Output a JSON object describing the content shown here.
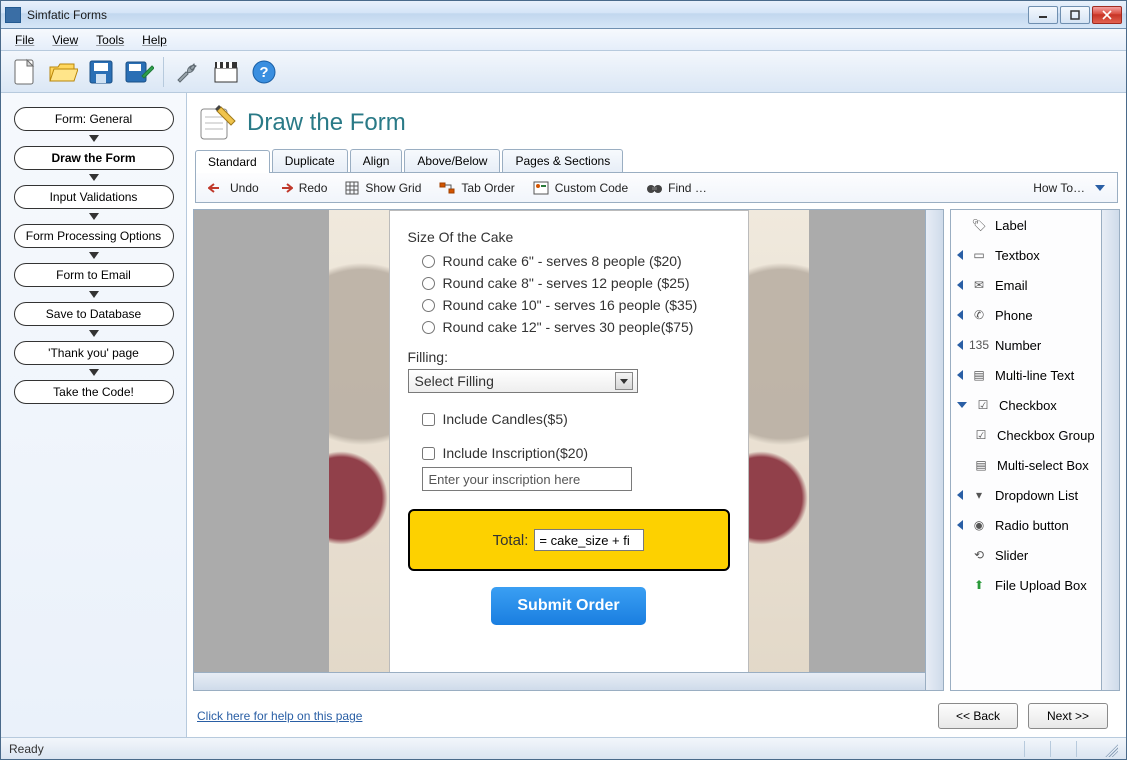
{
  "window": {
    "title": "Simfatic Forms"
  },
  "menu": {
    "file": "File",
    "view": "View",
    "tools": "Tools",
    "help": "Help"
  },
  "wizard": {
    "steps": [
      "Form: General",
      "Draw the Form",
      "Input Validations",
      "Form Processing Options",
      "Form to Email",
      "Save to Database",
      "'Thank you' page",
      "Take the Code!"
    ],
    "active_index": 1
  },
  "page": {
    "title": "Draw the Form"
  },
  "tabs": {
    "items": [
      "Standard",
      "Duplicate",
      "Align",
      "Above/Below",
      "Pages & Sections"
    ],
    "active_index": 0
  },
  "subtoolbar": {
    "undo": "Undo",
    "redo": "Redo",
    "show_grid": "Show Grid",
    "tab_order": "Tab Order",
    "custom_code": "Custom Code",
    "find": "Find …",
    "how_to": "How To…"
  },
  "form": {
    "size_label": "Size Of the Cake",
    "sizes": [
      "Round cake 6\" - serves 8 people ($20)",
      "Round cake 8\" - serves 12 people ($25)",
      "Round cake 10\" - serves 16 people ($35)",
      "Round cake 12\" - serves 30 people($75)"
    ],
    "filling_label": "Filling:",
    "filling_selected": "Select Filling",
    "include_candles": "Include Candles($5)",
    "include_inscription": "Include Inscription($20)",
    "inscription_placeholder": "Enter your inscription here",
    "total_label": "Total:",
    "total_formula": "= cake_size + fi",
    "submit_label": "Submit Order"
  },
  "palette": {
    "items": [
      {
        "label": "Label",
        "expand": "none"
      },
      {
        "label": "Textbox",
        "expand": "left"
      },
      {
        "label": "Email",
        "expand": "left"
      },
      {
        "label": "Phone",
        "expand": "left"
      },
      {
        "label": "Number",
        "expand": "left"
      },
      {
        "label": "Multi-line Text",
        "expand": "left"
      },
      {
        "label": "Checkbox",
        "expand": "down"
      },
      {
        "label": "Checkbox Group",
        "expand": "none"
      },
      {
        "label": "Multi-select Box",
        "expand": "none"
      },
      {
        "label": "Dropdown List",
        "expand": "left"
      },
      {
        "label": "Radio button",
        "expand": "left"
      },
      {
        "label": "Slider",
        "expand": "none"
      },
      {
        "label": "File Upload Box",
        "expand": "none"
      }
    ]
  },
  "footer": {
    "help_link": "Click here for help on this page",
    "back": "<< Back",
    "next": "Next >>"
  },
  "status": {
    "text": "Ready"
  }
}
